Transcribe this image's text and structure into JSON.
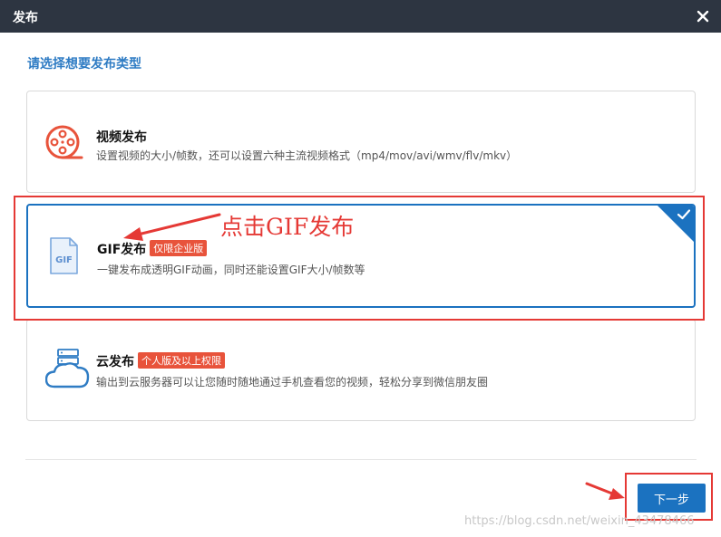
{
  "dialog": {
    "title": "发布",
    "subtitle": "请选择想要发布类型"
  },
  "options": [
    {
      "name": "视频发布",
      "badge": "",
      "description": "设置视频的大小/帧数，还可以设置六种主流视频格式（mp4/mov/avi/wmv/flv/mkv）",
      "selected": false
    },
    {
      "name": "GIF发布",
      "badge": "仅限企业版",
      "description": "一键发布成透明GIF动画，同时还能设置GIF大小/帧数等",
      "icon_label": "GIF",
      "selected": true
    },
    {
      "name": "云发布",
      "badge": "个人版及以上权限",
      "description": "输出到云服务器可以让您随时随地通过手机查看您的视频，轻松分享到微信朋友圈",
      "selected": false
    }
  ],
  "footer": {
    "next_label": "下一步"
  },
  "annotation": {
    "text": "点击GIF发布"
  },
  "watermark": "https://blog.csdn.net/weixin_43478466",
  "colors": {
    "titlebar": "#2d3541",
    "accent": "#1b72c0",
    "subtitle": "#2f7cc4",
    "badge": "#e8533b",
    "annotation": "#e53935"
  },
  "icons": [
    "close-icon",
    "film-reel-icon",
    "gif-file-icon",
    "cloud-server-icon",
    "check-icon"
  ]
}
